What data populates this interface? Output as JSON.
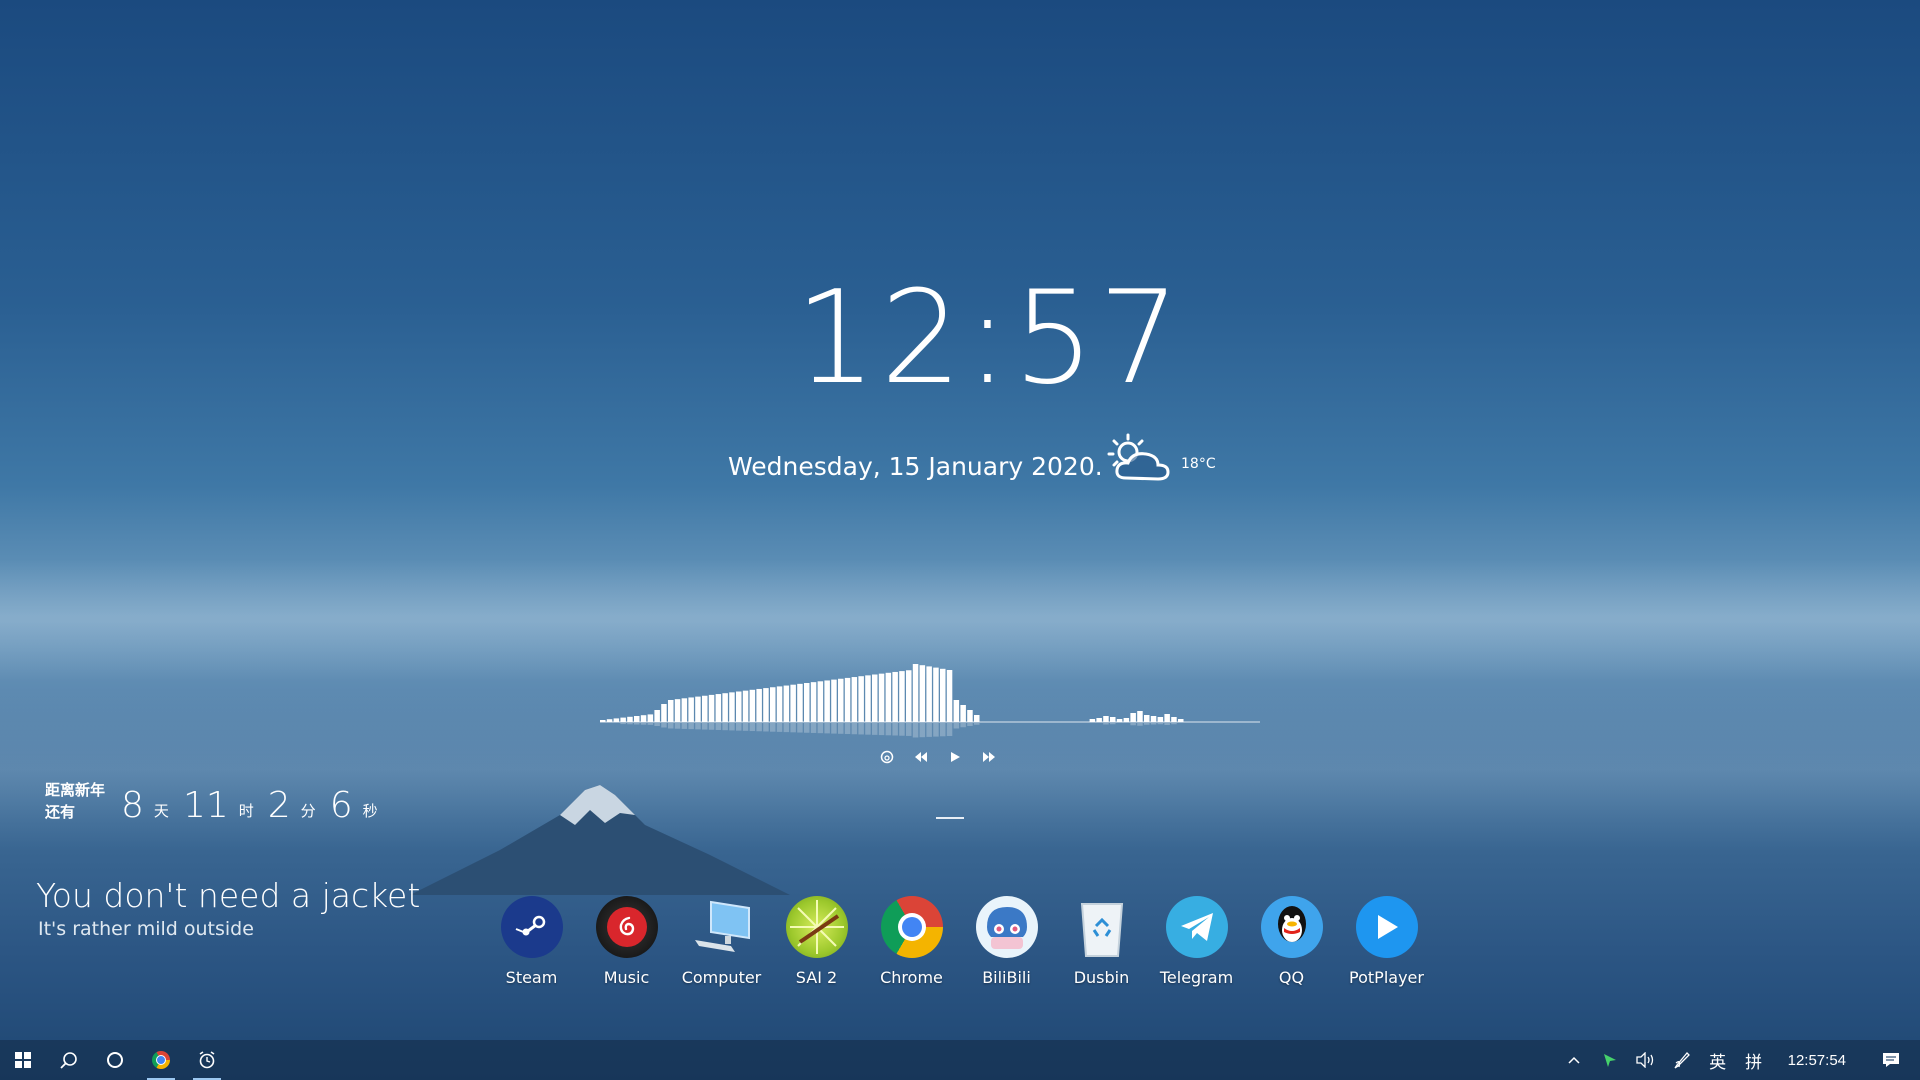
{
  "clock": {
    "time": "12:57"
  },
  "date": {
    "text": "Wednesday, 15 January 2020."
  },
  "weather": {
    "icon": "partly-cloudy-icon",
    "temperature": "18°C",
    "headline": "You don't need a jacket",
    "subline": "It's rather mild outside"
  },
  "countdown": {
    "label_line1": "距离新年",
    "label_line2": "还有",
    "days": "8",
    "days_unit": "天",
    "hours": "11",
    "hours_unit": "时",
    "minutes": "2",
    "minutes_unit": "分",
    "seconds": "6",
    "seconds_unit": "秒"
  },
  "media": {
    "controls": [
      "netease-icon",
      "previous-icon",
      "play-icon",
      "next-icon"
    ]
  },
  "dock": {
    "items": [
      {
        "label": "Steam",
        "icon": "steam-icon"
      },
      {
        "label": "Music",
        "icon": "netease-music-icon"
      },
      {
        "label": "Computer",
        "icon": "computer-icon"
      },
      {
        "label": "SAI 2",
        "icon": "sai-icon"
      },
      {
        "label": "Chrome",
        "icon": "chrome-icon"
      },
      {
        "label": "BiliBili",
        "icon": "bilibili-icon"
      },
      {
        "label": "Dusbin",
        "icon": "recycle-bin-icon"
      },
      {
        "label": "Telegram",
        "icon": "telegram-icon"
      },
      {
        "label": "QQ",
        "icon": "qq-icon"
      },
      {
        "label": "PotPlayer",
        "icon": "potplayer-icon"
      }
    ]
  },
  "taskbar": {
    "left": [
      "windows-start-icon",
      "search-icon",
      "cortana-icon",
      "chrome-icon",
      "alarm-icon"
    ],
    "tray": {
      "ime_lang": "英",
      "ime_mode": "拼",
      "time": "12:57:54"
    }
  },
  "colors": {
    "accent": "#9cc7f0",
    "sky_top": "#1b4a7f",
    "haze": "#6f9cbf"
  }
}
